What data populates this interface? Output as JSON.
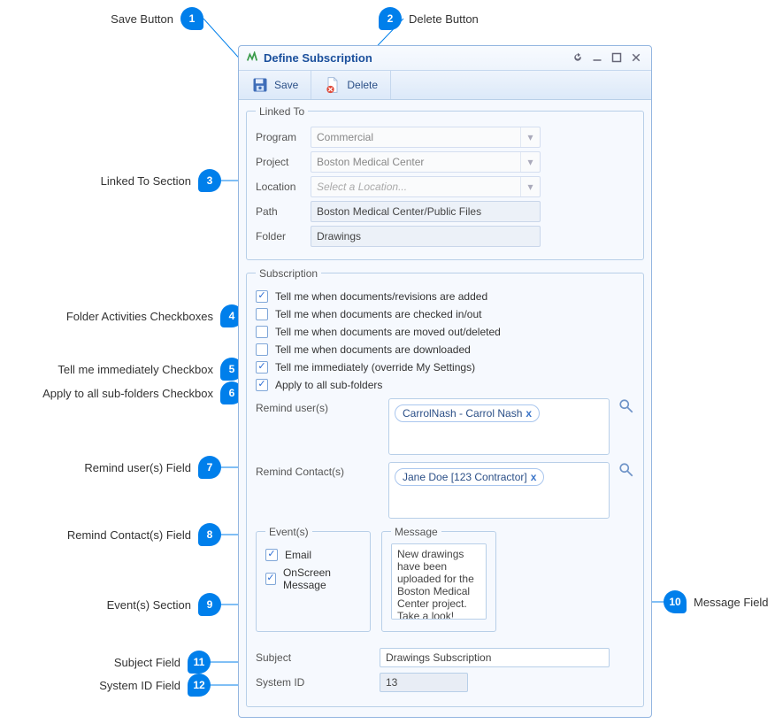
{
  "window": {
    "title": "Define Subscription"
  },
  "toolbar": {
    "save_label": "Save",
    "delete_label": "Delete"
  },
  "linked_to": {
    "legend": "Linked To",
    "program_label": "Program",
    "program_value": "Commercial",
    "project_label": "Project",
    "project_value": "Boston Medical Center",
    "location_label": "Location",
    "location_placeholder": "Select a Location...",
    "path_label": "Path",
    "path_value": "Boston Medical Center/Public Files",
    "folder_label": "Folder",
    "folder_value": "Drawings"
  },
  "subscription": {
    "legend": "Subscription",
    "chk_added": "Tell me when documents/revisions are added",
    "chk_inout": "Tell me when documents are checked in/out",
    "chk_moved": "Tell me when documents are moved out/deleted",
    "chk_downloaded": "Tell me when documents are downloaded",
    "chk_immediate": "Tell me immediately (override My Settings)",
    "chk_subfolders": "Apply to all sub-folders",
    "remind_users_label": "Remind user(s)",
    "remind_users_token": "CarrolNash - Carrol Nash",
    "remind_contacts_label": "Remind Contact(s)",
    "remind_contacts_token": "Jane Doe [123 Contractor]",
    "events_legend": "Event(s)",
    "event_email": "Email",
    "event_onscreen": "OnScreen Message",
    "message_legend": "Message",
    "message_value": "New drawings have been uploaded for the Boston Medical Center project. Take a look!",
    "subject_label": "Subject",
    "subject_value": "Drawings Subscription",
    "systemid_label": "System ID",
    "systemid_value": "13"
  },
  "callouts": {
    "c1": "Save Button",
    "c2": "Delete Button",
    "c3": "Linked To Section",
    "c4": "Folder Activities Checkboxes",
    "c5": "Tell me immediately Checkbox",
    "c6": "Apply to all sub-folders Checkbox",
    "c7": "Remind user(s) Field",
    "c8": "Remind Contact(s) Field",
    "c9": "Event(s) Section",
    "c10": "Message Field",
    "c11": "Subject Field",
    "c12": "System ID Field"
  }
}
